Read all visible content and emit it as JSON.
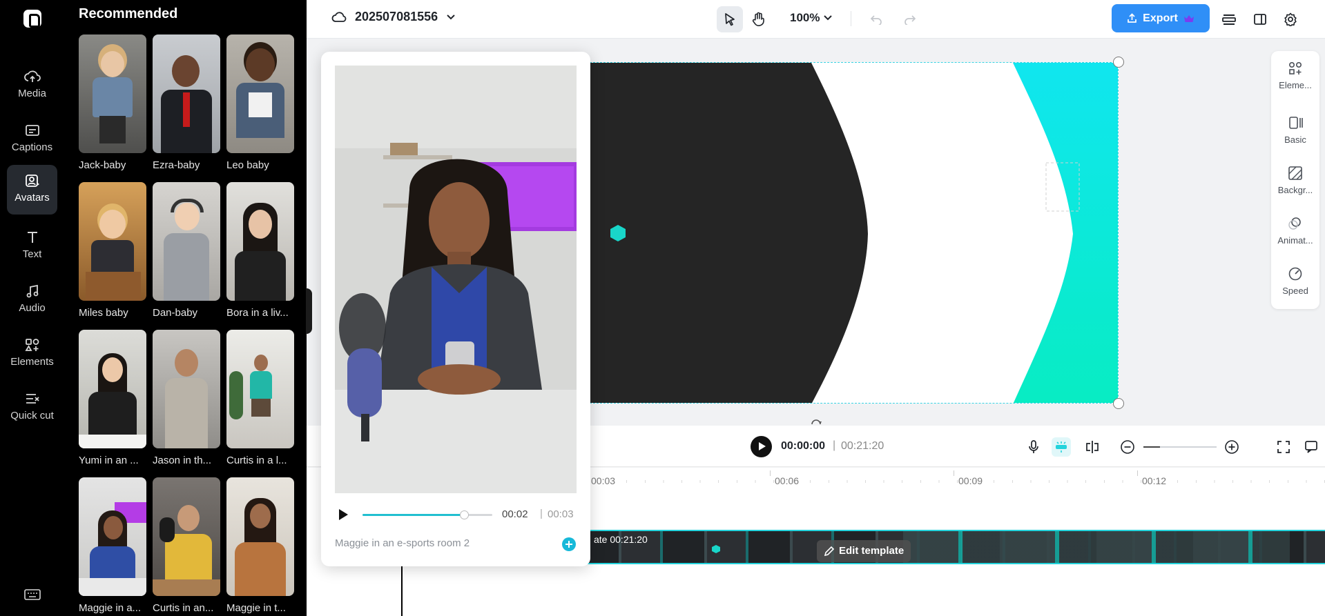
{
  "app": {
    "project_name": "202507081556",
    "zoom_level": "100%",
    "export_label": "Export",
    "accent_color": "#2f8ff7",
    "highlight_color": "#23d3dc"
  },
  "rail": {
    "items": [
      {
        "label": "Media",
        "icon": "cloud-upload-icon"
      },
      {
        "label": "Captions",
        "icon": "captions-icon"
      },
      {
        "label": "Avatars",
        "icon": "avatar-icon"
      },
      {
        "label": "Text",
        "icon": "text-icon"
      },
      {
        "label": "Audio",
        "icon": "music-note-icon"
      },
      {
        "label": "Elements",
        "icon": "elements-icon"
      },
      {
        "label": "Quick cut",
        "icon": "quick-cut-icon"
      }
    ],
    "active_item": "Avatars"
  },
  "panel": {
    "title": "Recommended",
    "avatars": [
      {
        "label": "Jack-baby"
      },
      {
        "label": "Ezra-baby"
      },
      {
        "label": "Leo baby"
      },
      {
        "label": "Miles baby"
      },
      {
        "label": "Dan-baby"
      },
      {
        "label": "Bora in a liv..."
      },
      {
        "label": "Yumi in an ..."
      },
      {
        "label": "Jason in th..."
      },
      {
        "label": "Curtis in a l..."
      },
      {
        "label": "Maggie in a..."
      },
      {
        "label": "Curtis in an..."
      },
      {
        "label": "Maggie in t..."
      }
    ]
  },
  "properties": {
    "items": [
      {
        "label": "Eleme...",
        "icon": "elements-icon"
      },
      {
        "label": "Basic",
        "icon": "basic-icon"
      },
      {
        "label": "Backgr...",
        "icon": "background-icon"
      },
      {
        "label": "Animat...",
        "icon": "animation-icon"
      },
      {
        "label": "Speed",
        "icon": "speed-icon"
      }
    ]
  },
  "playback": {
    "current_time": "00:00:00",
    "separator": "|",
    "total_time": "00:21:20"
  },
  "timeline": {
    "ruler": [
      "00:03",
      "00:06",
      "00:09",
      "00:12"
    ],
    "track_label": "ate   00:21:20",
    "edit_template_label": "Edit template"
  },
  "preview": {
    "current_time": "00:02",
    "separator": "|",
    "total_time": "00:03",
    "progress": 0.78,
    "name": "Maggie in an e-sports room 2"
  }
}
